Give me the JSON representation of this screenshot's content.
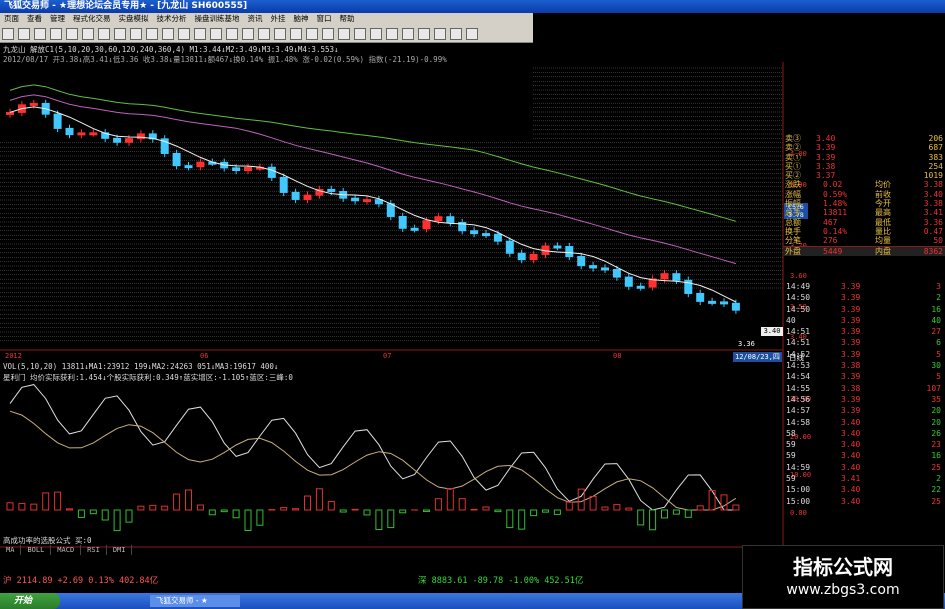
{
  "window": {
    "title": "飞狐交易师 - ★理想论坛会员专用★ - [九龙山 SH600555]"
  },
  "menu": [
    "页面",
    "查看",
    "管理",
    "程式化交易",
    "实盘模拟",
    "技术分析",
    "操盘训练基地",
    "资讯",
    "外挂",
    "脑神",
    "窗口",
    "帮助"
  ],
  "chart": {
    "header1": "九龙山 解放C1(5,10,20,30,60,120,240,360,4) M1:3.44↓M2:3.49↓M3:3.49↓M4:3.553↓",
    "header2": "2012/08/17 开3.38↓高3.41↓低3.36 收3.38↓量13811↓额467↓换0.14% 振1.48% 涨-0.02(0.59%) 指数(-21.19)-0.99%",
    "price_axis": [
      "4.00",
      "3.90",
      "3.80",
      "3.70",
      "3.60",
      "3.50",
      "3.40"
    ],
    "flag1": "C5?6\n3.78",
    "flag2": "3.40",
    "low_mark": "3.36",
    "date_labels": [
      "2012",
      "06",
      "07",
      "08"
    ],
    "cursor_date": "12/08/23,四",
    "period": "日线",
    "vol_header": "VOL(5,10,20) 13811↓MA1:23912 199↓MA2:24263 051↓MA3:19617 400↓",
    "ind_header": "星利门 均价实际获利:1.454↓个股实际获利:0.349↑蓝实增区:-1.105↑蓝区:三峰:0",
    "ind_axis": [
      "30.00",
      "20.00",
      "10.00",
      "0.00",
      "-10.00"
    ],
    "formula_label": "高成功率的选股公式 买:0"
  },
  "tabs": [
    "MA",
    "BOLL",
    "MACD",
    "RSI",
    "DMI"
  ],
  "quote": [
    [
      "卖③",
      "3.40",
      "206"
    ],
    [
      "卖②",
      "3.39",
      "687"
    ],
    [
      "卖①",
      "3.39",
      "383"
    ],
    [
      "买①",
      "3.38",
      "254"
    ],
    [
      "买②",
      "3.37",
      "1019"
    ],
    [
      "涨跌",
      "0.02",
      "均价",
      "3.38"
    ],
    [
      "涨幅",
      "0.59%",
      "前收",
      "3.40"
    ],
    [
      "振幅",
      "1.48%",
      "今开",
      "3.38"
    ],
    [
      "总手",
      "13811",
      "最高",
      "3.41"
    ],
    [
      "总额",
      "467",
      "最低",
      "3.36"
    ],
    [
      "换手",
      "0.14%",
      "量比",
      "0.47"
    ],
    [
      "分笔",
      "276",
      "均量",
      "50"
    ],
    [
      "外盘",
      "5449",
      "内盘",
      "8362"
    ]
  ],
  "ticks": [
    [
      "14:49",
      "3.39",
      "3"
    ],
    [
      "14:50",
      "3.39",
      "2"
    ],
    [
      "14:50",
      "3.39",
      "16"
    ],
    [
      "40",
      "3.39",
      "40"
    ],
    [
      "14:51",
      "3.39",
      "27"
    ],
    [
      "14:51",
      "3.39",
      "6"
    ],
    [
      "14:52",
      "3.39",
      "5"
    ],
    [
      "14:53",
      "3.38",
      "30"
    ],
    [
      "14:54",
      "3.39",
      "5"
    ],
    [
      "14:55",
      "3.38",
      "107"
    ],
    [
      "14:56",
      "3.39",
      "35"
    ],
    [
      "14:57",
      "3.39",
      "20"
    ],
    [
      "14:58",
      "3.40",
      "20"
    ],
    [
      "58",
      "3.40",
      "26"
    ],
    [
      "59",
      "3.40",
      "23"
    ],
    [
      "59",
      "3.40",
      "16"
    ],
    [
      "14:59",
      "3.40",
      "25"
    ],
    [
      "59",
      "3.41",
      "2"
    ],
    [
      "15:00",
      "3.40",
      "22"
    ],
    [
      "15:00",
      "3.40",
      "25"
    ]
  ],
  "status": {
    "sh": "沪 2114.89  +2.69  0.13% 402.84亿",
    "sz": "深 8883.61  -89.78  -1.00% 452.51亿"
  },
  "taskbar": {
    "start": "开始",
    "app": "飞狐交易师 - ★"
  },
  "watermark": {
    "line1": "指标公式网",
    "line2": "www.zbgs3.com"
  }
}
